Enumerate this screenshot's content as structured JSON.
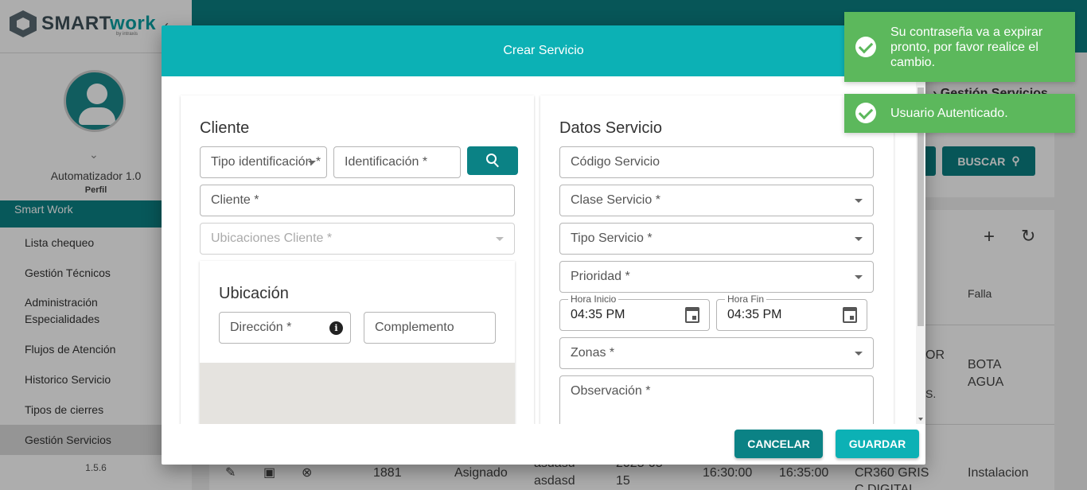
{
  "brand": {
    "name_a": "SMART",
    "name_b": "WORK",
    "sub": "by intraxis"
  },
  "sidebar": {
    "user_name": "Automatizador 1.0",
    "profile_label": "Perfil",
    "section_label": "Smart Work",
    "items": [
      {
        "label": "Lista chequeo"
      },
      {
        "label": "Gestión Técnicos"
      },
      {
        "label": "Administración Especialidades"
      },
      {
        "label": "Flujos de Atención"
      },
      {
        "label": "Historico Servicio"
      },
      {
        "label": "Tipos de cierres"
      },
      {
        "label": "Gestión Servicios"
      }
    ],
    "version": "1.5.6"
  },
  "background": {
    "breadcrumb": "Gestión Servicios",
    "buscar_label": "BUSCAR",
    "column_falla": "Falla",
    "row1": {
      "col_a": "OR",
      "col_b": "S.",
      "falla": "BOTA AGUA"
    },
    "row2": {
      "id": "1881",
      "estado": "Asignado",
      "desc1": "asdasd",
      "desc2": "asdasd",
      "fecha1": "2025-05-",
      "fecha2": "15",
      "hora_inicio": "16:30:00",
      "hora_fin": "16:35:00",
      "vehiculo1": "CR360 GRIS",
      "vehiculo2": "C DIGITAL",
      "falla": "Instalacion"
    }
  },
  "modal": {
    "title": "Crear Servicio",
    "cliente": {
      "section_title": "Cliente",
      "tipo_identificacion": "Tipo identificación *",
      "identificacion": "Identificación *",
      "cliente": "Cliente *",
      "ubicaciones": "Ubicaciones Cliente *"
    },
    "ubicacion": {
      "section_title": "Ubicación",
      "direccion": "Dirección *",
      "complemento": "Complemento"
    },
    "servicio": {
      "section_title": "Datos Servicio",
      "codigo": "Código Servicio",
      "clase": "Clase Servicio *",
      "tipo": "Tipo Servicio *",
      "prioridad": "Prioridad *",
      "hora_inicio_label": "Hora Inicio",
      "hora_inicio_value": "04:35 PM",
      "hora_fin_label": "Hora Fin",
      "hora_fin_value": "04:35 PM",
      "zonas": "Zonas *",
      "observacion": "Observación *"
    },
    "cancel_label": "CANCELAR",
    "save_label": "GUARDAR"
  },
  "toasts": [
    {
      "message": "Su contraseña va a expirar pronto, por favor realice el cambio."
    },
    {
      "message": "Usuario Autenticado."
    }
  ],
  "colors": {
    "primary": "#0cb1b5",
    "primary_dark": "#0b8285",
    "success": "#5cb85c"
  }
}
